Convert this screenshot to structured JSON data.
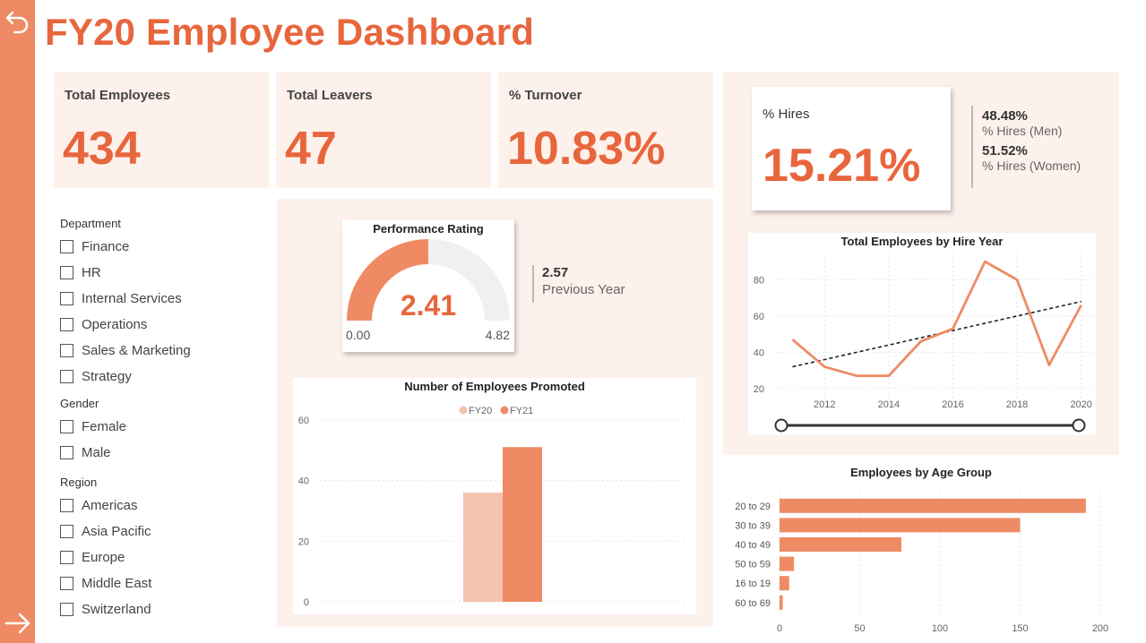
{
  "page": {
    "title": "FY20 Employee Dashboard"
  },
  "nav": {
    "back_icon": "undo-arrow-icon",
    "next_icon": "arrow-right-icon"
  },
  "kpis": [
    {
      "label": "Total Employees",
      "value": "434"
    },
    {
      "label": "Total Leavers",
      "value": "47"
    },
    {
      "label": "% Turnover",
      "value": "10.83%"
    }
  ],
  "hires": {
    "label": "% Hires",
    "value": "15.21%",
    "men_value": "48.48%",
    "men_label": "% Hires (Men)",
    "women_value": "51.52%",
    "women_label": "% Hires (Women)"
  },
  "filters": {
    "department": {
      "label": "Department",
      "items": [
        "Finance",
        "HR",
        "Internal Services",
        "Operations",
        "Sales & Marketing",
        "Strategy"
      ]
    },
    "gender": {
      "label": "Gender",
      "items": [
        "Female",
        "Male"
      ]
    },
    "region": {
      "label": "Region",
      "items": [
        "Americas",
        "Asia Pacific",
        "Europe",
        "Middle East",
        "Switzerland"
      ]
    }
  },
  "performance": {
    "title": "Performance Rating",
    "value": "2.41",
    "min": "0.00",
    "max": "4.82",
    "previous_value": "2.57",
    "previous_label": "Previous Year"
  },
  "colors": {
    "accent": "#e8663d",
    "bar": "#ee8b64",
    "bar_light": "#f4c3ae",
    "panel": "#fdf1ec",
    "rail": "#ee8b64"
  },
  "chart_data": [
    {
      "type": "bar",
      "title": "Number of Employees Promoted",
      "categories": [
        ""
      ],
      "series": [
        {
          "name": "FY20",
          "values": [
            36
          ]
        },
        {
          "name": "FY21",
          "values": [
            51
          ]
        }
      ],
      "yticks": [
        0,
        20,
        40,
        60
      ],
      "ylim": [
        0,
        62
      ],
      "legend": "top-center",
      "grid": true
    },
    {
      "type": "line",
      "title": "Total Employees by Hire Year",
      "x": [
        2011,
        2012,
        2013,
        2014,
        2015,
        2016,
        2017,
        2018,
        2019,
        2020
      ],
      "y": [
        47,
        32,
        27,
        27,
        46,
        53,
        90,
        80,
        33,
        66
      ],
      "xticks": [
        2012,
        2014,
        2016,
        2018,
        2020
      ],
      "yticks": [
        20,
        40,
        60,
        80
      ],
      "xlim": [
        2010.4,
        2020.4
      ],
      "ylim": [
        15,
        95
      ],
      "trendline": {
        "x": [
          2011,
          2020
        ],
        "y": [
          32,
          68
        ]
      },
      "grid": true
    },
    {
      "type": "bar",
      "orientation": "horizontal",
      "title": "Employees by Age Group",
      "categories": [
        "20 to 29",
        "30 to 39",
        "40 to 49",
        "50 to 59",
        "16 to 19",
        "60 to 69"
      ],
      "values": [
        191,
        150,
        76,
        9,
        6,
        2
      ],
      "xticks": [
        0,
        50,
        100,
        150,
        200
      ],
      "xlim": [
        0,
        200
      ],
      "grid": true
    }
  ]
}
